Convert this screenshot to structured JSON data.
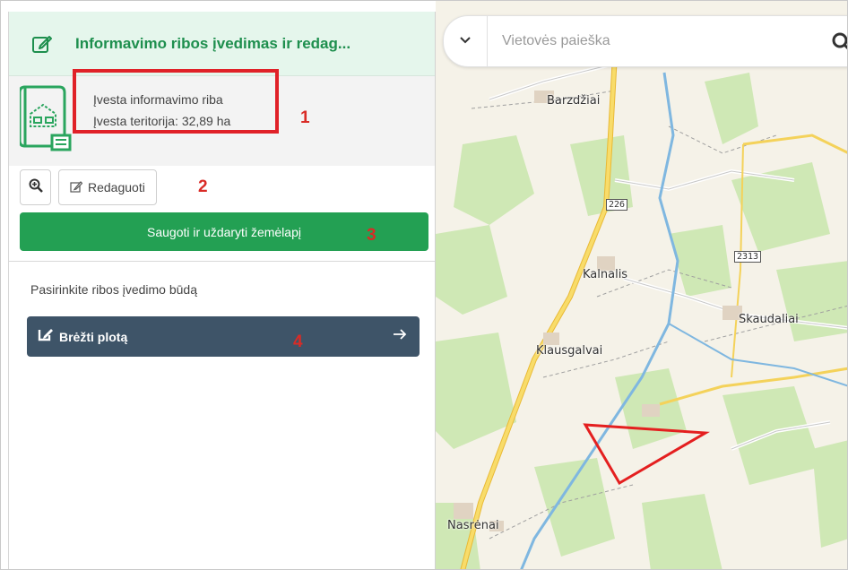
{
  "panel": {
    "title": "Informavimo ribos įvedimas ir redag...",
    "status_line_1": "Įvesta informavimo riba",
    "status_line_2": "Įvesta teritorija: 32,89 ha",
    "edit_label": "Redaguoti",
    "save_label": "Saugoti ir uždaryti žemėlapį",
    "prompt": "Pasirinkite ribos įvedimo būdą",
    "draw_label": "Brėžti plotą"
  },
  "callouts": [
    "1",
    "2",
    "3",
    "4"
  ],
  "search": {
    "placeholder": "Vietovės paieška"
  },
  "map": {
    "places": [
      "Barzdžiai",
      "Kalnalis",
      "Skaudaliai",
      "Klausgalvai",
      "Nasrėnai"
    ],
    "road_badges": [
      "226",
      "2313"
    ]
  },
  "colors": {
    "header_bg": "#e5f6ec",
    "brand_green": "#23a053",
    "draw_button": "#3e5468",
    "callout_red": "#d92b26"
  },
  "icons": [
    "edit-square-icon",
    "land-plan-icon",
    "zoom-in-icon",
    "pencil-icon",
    "draw-shape-icon",
    "arrow-right-icon",
    "chevron-down-icon",
    "search-icon"
  ]
}
